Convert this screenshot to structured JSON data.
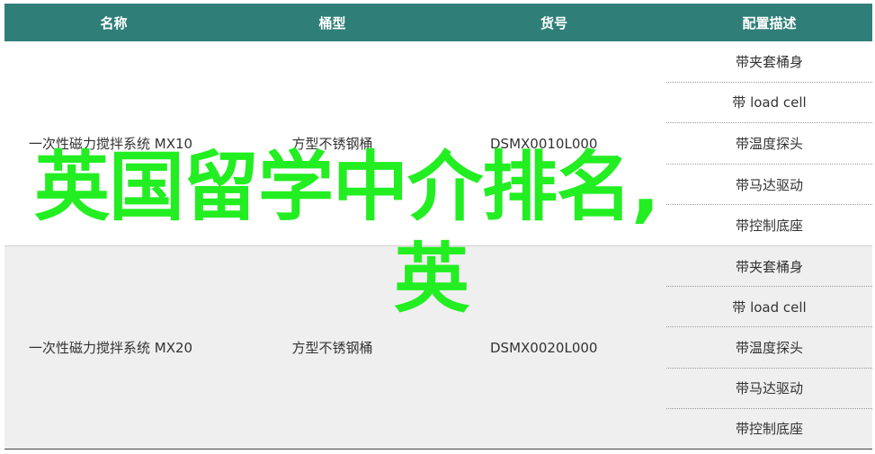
{
  "table": {
    "headers": [
      "名称",
      "桶型",
      "货号",
      "配置描述"
    ],
    "rows": [
      {
        "name": "一次性磁力搅拌系统 MX10",
        "type": "方型不锈钢桶",
        "sku": "DSMX0010L000",
        "config": [
          "带夹套桶身",
          "带 load cell",
          "带温度探头",
          "带马达驱动",
          "带控制底座"
        ]
      },
      {
        "name": "一次性磁力搅拌系统 MX20",
        "type": "方型不锈钢桶",
        "sku": "DSMX0020L000",
        "config": [
          "带夹套桶身",
          "带 load cell",
          "带温度探头",
          "带马达驱动",
          "带控制底座"
        ]
      }
    ]
  },
  "overlay": {
    "line1": "英国留学中介排名,",
    "line2": "英"
  },
  "colors": {
    "header_bg": "#2f7f78",
    "overlay_text": "#22ee22",
    "row2_bg": "#efefef"
  }
}
